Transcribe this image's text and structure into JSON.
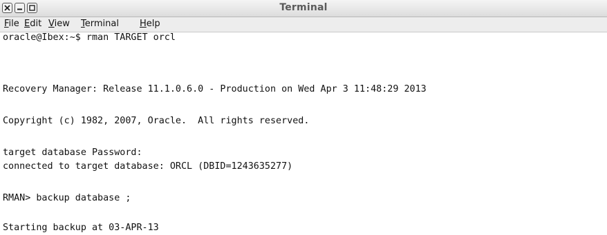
{
  "window": {
    "title": "Terminal",
    "close_icon": "close-icon",
    "minimize_icon": "minimize-icon",
    "maximize_icon": "maximize-icon"
  },
  "menubar": {
    "items": [
      {
        "mnemonic": "F",
        "rest": "ile"
      },
      {
        "mnemonic": "E",
        "rest": "dit"
      },
      {
        "mnemonic": "V",
        "rest": "iew"
      },
      {
        "mnemonic": "T",
        "rest": "erminal"
      },
      {
        "mnemonic": "H",
        "rest": "elp"
      }
    ]
  },
  "terminal": {
    "lines": [
      "oracle@Ibex:~$ rman TARGET orcl",
      "",
      "Recovery Manager: Release 11.1.0.6.0 - Production on Wed Apr 3 11:48:29 2013",
      "",
      "Copyright (c) 1982, 2007, Oracle.  All rights reserved.",
      "",
      "target database Password:",
      "connected to target database: ORCL (DBID=1243635277)",
      "",
      "RMAN> backup database ;",
      "",
      "Starting backup at 03-APR-13"
    ]
  }
}
